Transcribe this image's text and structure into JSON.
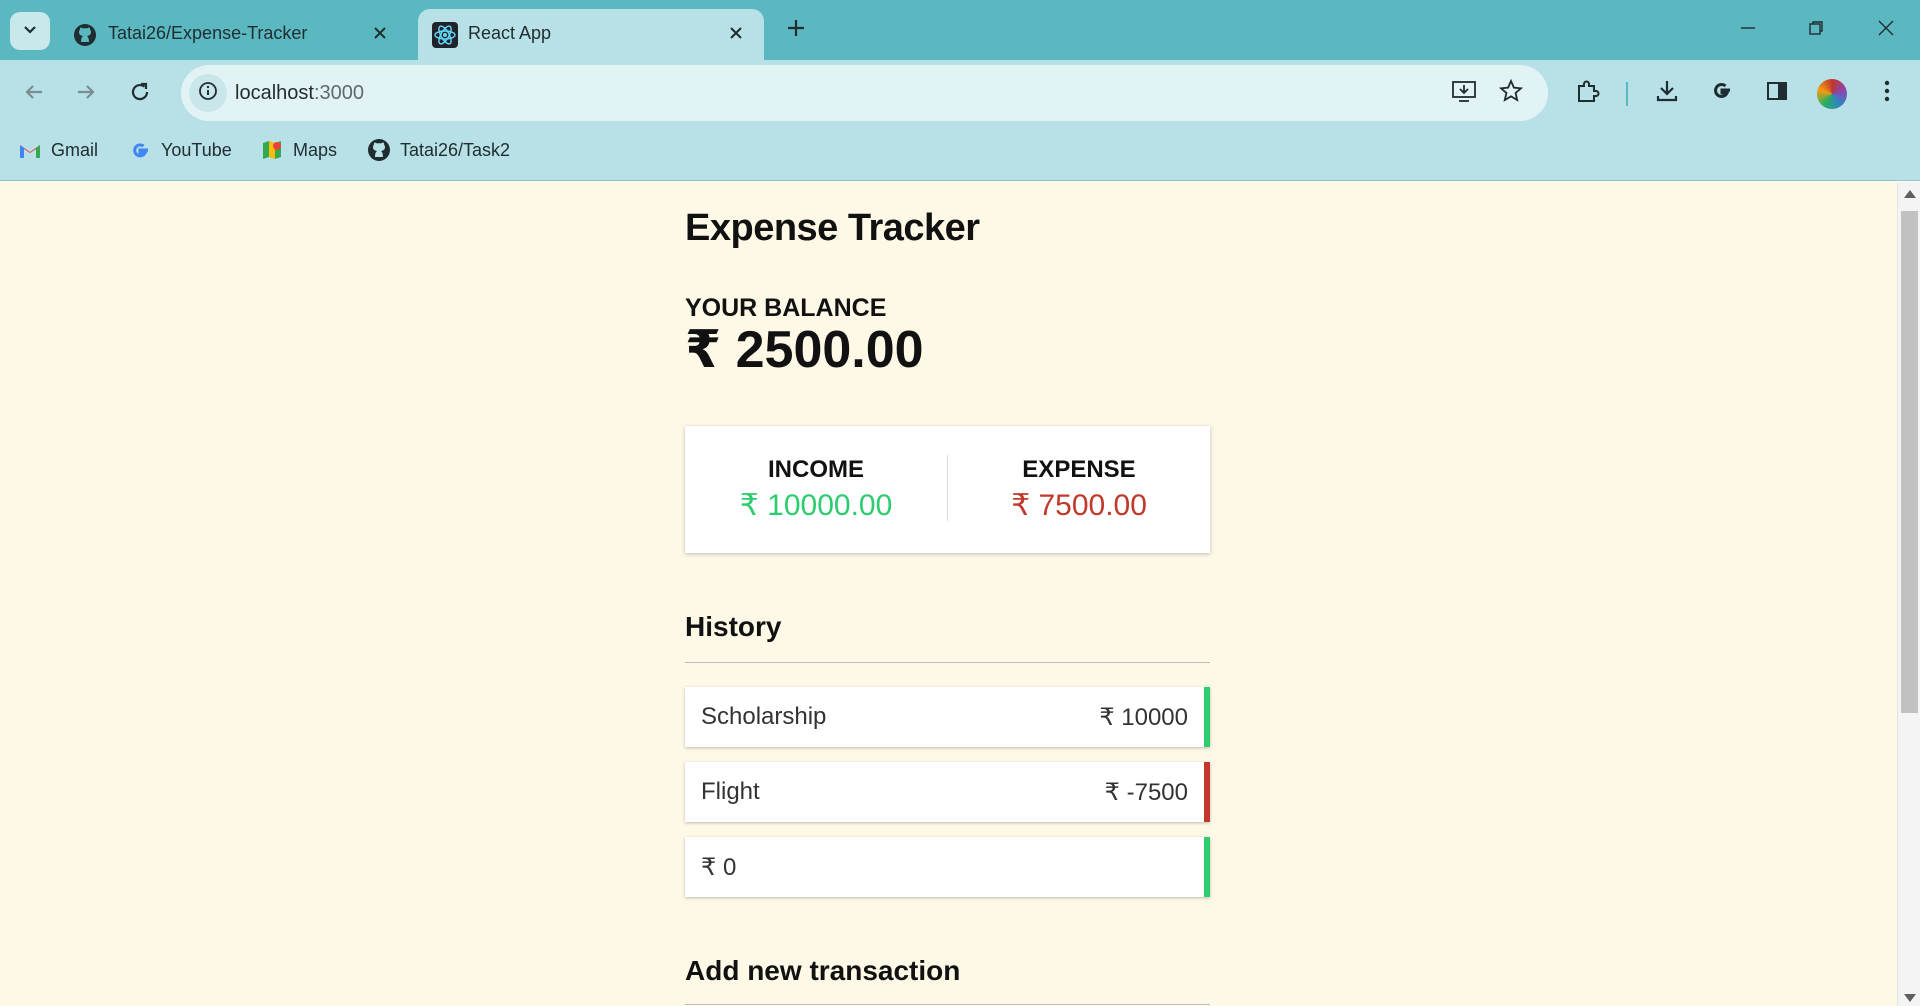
{
  "browser": {
    "tabs": [
      {
        "title": "Tatai26/Expense-Tracker",
        "icon": "github-icon",
        "active": false
      },
      {
        "title": "React App",
        "icon": "react-icon",
        "active": true
      }
    ],
    "url": {
      "host": "localhost",
      "port": ":3000"
    },
    "bookmarks": [
      {
        "label": "Gmail",
        "icon": "gmail-icon"
      },
      {
        "label": "YouTube",
        "icon": "google-icon"
      },
      {
        "label": "Maps",
        "icon": "maps-icon"
      },
      {
        "label": "Tatai26/Task2",
        "icon": "github-icon"
      }
    ],
    "colors": {
      "tabstrip": "#5bb8c0",
      "toolbar": "#b7e1e6"
    }
  },
  "app": {
    "title": "Expense Tracker",
    "balance_label": "YOUR BALANCE",
    "balance": "₹ 2500.00",
    "income_label": "INCOME",
    "income": "₹ 10000.00",
    "expense_label": "EXPENSE",
    "expense": "₹ 7500.00",
    "history_title": "History",
    "history": [
      {
        "name": "Scholarship",
        "amount": "₹ 10000",
        "type": "plus"
      },
      {
        "name": "Flight",
        "amount": "₹ -7500",
        "type": "minus"
      },
      {
        "name": "",
        "amount": "₹ 0",
        "type": "plus"
      }
    ],
    "add_title": "Add new transaction",
    "colors": {
      "background": "#fef9e6",
      "plus": "#2ecc71",
      "minus": "#c0392b"
    }
  }
}
